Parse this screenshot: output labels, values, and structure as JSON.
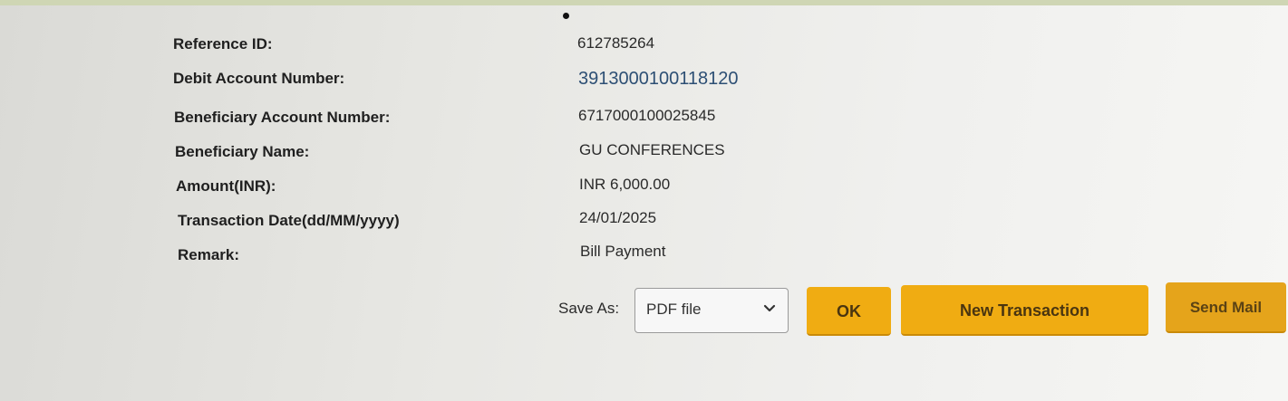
{
  "details": [
    {
      "label": "Reference ID:",
      "value": "612785264"
    },
    {
      "label": "Debit Account Number:",
      "value": "3913000100118120"
    },
    {
      "label": "Beneficiary Account Number:",
      "value": "6717000100025845"
    },
    {
      "label": "Beneficiary Name:",
      "value": "GU CONFERENCES"
    },
    {
      "label": "Amount(INR):",
      "value": "INR 6,000.00"
    },
    {
      "label": "Transaction Date(dd/MM/yyyy)",
      "value": "24/01/2025"
    },
    {
      "label": "Remark:",
      "value": "Bill Payment"
    }
  ],
  "actions": {
    "save_as_label": "Save As:",
    "save_as_selected": "PDF file",
    "ok_label": "OK",
    "new_transaction_label": "New Transaction",
    "send_mail_label": "Send Mail"
  },
  "colors": {
    "button": "#f0ac12",
    "link": "#2d4f74"
  },
  "icons": {
    "select_chevron": "chevron-down-icon"
  }
}
